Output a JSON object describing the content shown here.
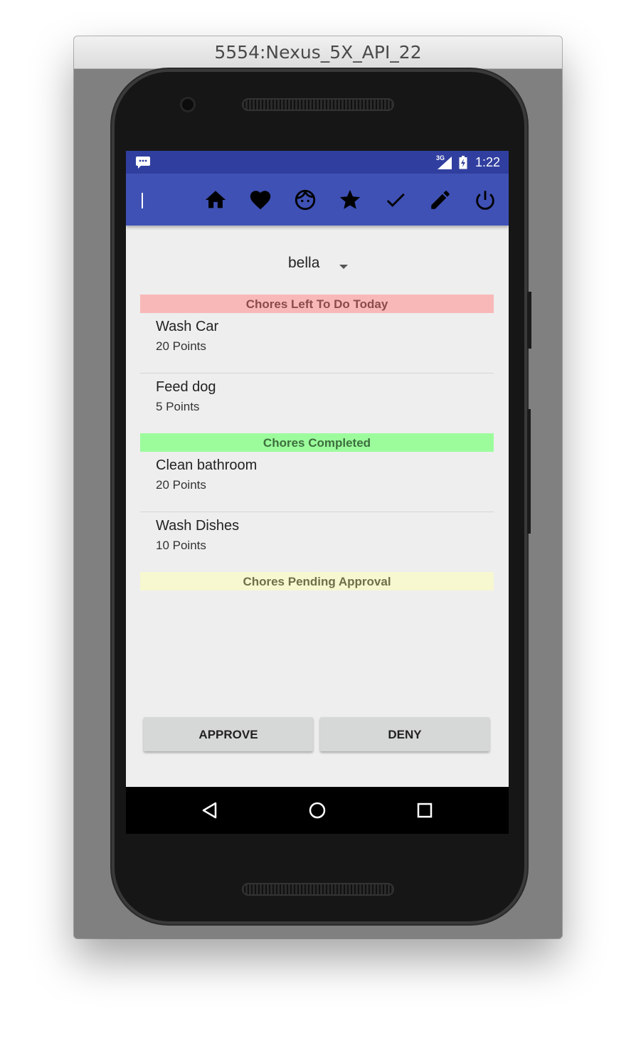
{
  "window": {
    "title": "5554:Nexus_5X_API_22"
  },
  "status_bar": {
    "notification_icon": "message-icon",
    "network_label": "3G",
    "time": "1:22"
  },
  "toolbar": {
    "icons": [
      "home-icon",
      "heart-icon",
      "face-icon",
      "star-icon",
      "check-icon",
      "edit-icon",
      "power-icon"
    ]
  },
  "user_spinner": {
    "selected": "bella"
  },
  "sections": {
    "todo": {
      "title": "Chores Left To Do Today",
      "color": "#f9b8b8"
    },
    "completed": {
      "title": "Chores Completed",
      "color": "#9cfc9c"
    },
    "pending": {
      "title": "Chores Pending Approval",
      "color": "#f7f7d0"
    }
  },
  "todo_chores": [
    {
      "name": "Wash Car",
      "points": "20 Points"
    },
    {
      "name": "Feed dog",
      "points": "5 Points"
    }
  ],
  "completed_chores": [
    {
      "name": "Clean bathroom",
      "points": "20 Points"
    },
    {
      "name": "Wash Dishes",
      "points": "10 Points"
    }
  ],
  "buttons": {
    "approve": "APPROVE",
    "deny": "DENY"
  },
  "nav_bar": {
    "icons": [
      "back-icon",
      "home-circle-icon",
      "recents-icon"
    ]
  },
  "colors": {
    "primary": "#3f51b5",
    "primary_dark": "#303f9f"
  }
}
